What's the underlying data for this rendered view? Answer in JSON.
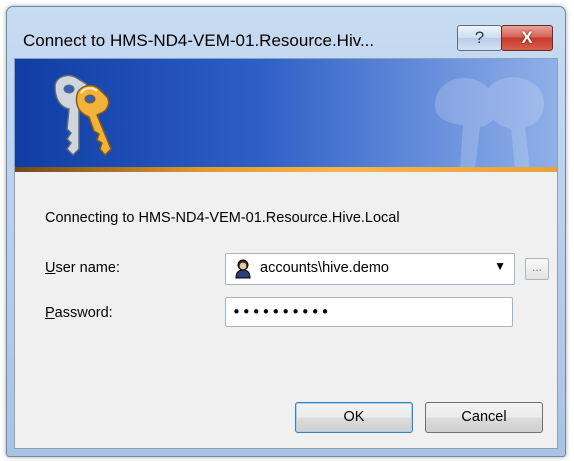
{
  "window": {
    "title": "Connect to HMS-ND4-VEM-01.Resource.Hiv...",
    "help_glyph": "?",
    "close_glyph": "X"
  },
  "banner": {
    "icon": "keys-icon",
    "watermark": "keys-watermark-icon"
  },
  "connecting_text": "Connecting to HMS-ND4-VEM-01.Resource.Hive.Local",
  "form": {
    "user_label_mnemonic": "U",
    "user_label_rest": "ser name:",
    "user_value": "accounts\\hive.demo",
    "user_icon": "user-account-icon",
    "dropdown_glyph": "▼",
    "browse_label": "...",
    "password_label_mnemonic": "P",
    "password_label_rest": "assword:",
    "password_masked": "••••••••••"
  },
  "buttons": {
    "ok": "OK",
    "cancel": "Cancel"
  },
  "colors": {
    "banner_dark": "#0f3da3",
    "banner_light": "#8fb0e8",
    "accent_line": "#e39a2a",
    "close_red": "#c7382a"
  }
}
